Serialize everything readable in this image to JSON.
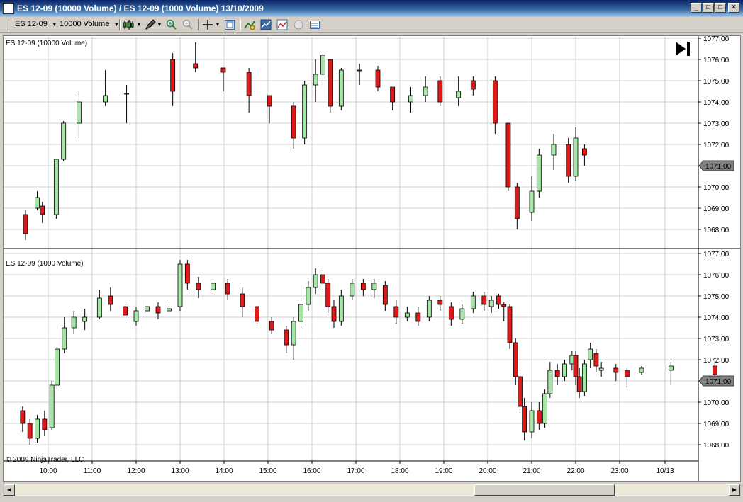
{
  "window": {
    "title": "ES 12-09 (10000 Volume) / ES 12-09 (1000 Volume)  13/10/2009"
  },
  "toolbar": {
    "instrument": "ES 12-09",
    "interval": "10000 Volume"
  },
  "chart_data": [
    {
      "type": "candlestick",
      "title": "ES 12-09 (10000 Volume)",
      "ylim": [
        1067.5,
        1077.0
      ],
      "y_ticks": [
        "1077,00",
        "1076,00",
        "1075,00",
        "1074,00",
        "1073,00",
        "1072,00",
        "1071,00",
        "1070,00",
        "1069,00",
        "1068,00"
      ],
      "last_price": "1071,00",
      "candles": [
        [
          "09:29",
          1068.7,
          1067.8,
          1067.5,
          1068.9
        ],
        [
          "09:45",
          1069.0,
          1069.5,
          1068.9,
          1069.8
        ],
        [
          "09:52",
          1069.1,
          1068.7,
          1068.3,
          1069.3
        ],
        [
          "10:11",
          1068.7,
          1071.3,
          1068.5,
          1071.3
        ],
        [
          "10:21",
          1071.3,
          1073.0,
          1071.2,
          1073.1
        ],
        [
          "10:42",
          1073.0,
          1074.0,
          1072.3,
          1074.5
        ],
        [
          "11:18",
          1074.0,
          1074.3,
          1073.8,
          1075.5
        ],
        [
          "11:47",
          1074.4,
          1074.4,
          1073.0,
          1074.8
        ],
        [
          "12:50",
          1076.0,
          1074.5,
          1073.8,
          1076.3
        ],
        [
          "13:21",
          1075.8,
          1075.6,
          1075.4,
          1076.8
        ],
        [
          "13:59",
          1075.6,
          1075.4,
          1074.5,
          1075.6
        ],
        [
          "14:34",
          1075.4,
          1074.3,
          1073.5,
          1075.6
        ],
        [
          "15:02",
          1074.3,
          1073.8,
          1073.0,
          1074.3
        ],
        [
          "15:35",
          1073.8,
          1072.3,
          1071.8,
          1074.0
        ],
        [
          "15:50",
          1072.3,
          1074.8,
          1072.0,
          1075.0
        ],
        [
          "16:05",
          1074.8,
          1075.3,
          1074.0,
          1076.0
        ],
        [
          "16:15",
          1075.3,
          1076.2,
          1075.0,
          1076.3
        ],
        [
          "16:25",
          1076.0,
          1073.8,
          1073.5,
          1076.0
        ],
        [
          "16:40",
          1073.8,
          1075.5,
          1073.6,
          1075.6
        ],
        [
          "17:05",
          1075.5,
          1075.5,
          1074.8,
          1075.8
        ],
        [
          "17:30",
          1075.5,
          1074.7,
          1074.5,
          1075.7
        ],
        [
          "17:50",
          1074.7,
          1074.0,
          1073.6,
          1074.7
        ],
        [
          "18:15",
          1074.0,
          1074.3,
          1073.5,
          1074.7
        ],
        [
          "18:35",
          1074.3,
          1074.7,
          1074.0,
          1075.2
        ],
        [
          "18:55",
          1075.0,
          1074.0,
          1073.8,
          1075.2
        ],
        [
          "19:20",
          1074.2,
          1074.5,
          1073.8,
          1075.2
        ],
        [
          "19:40",
          1075.0,
          1074.6,
          1074.3,
          1075.2
        ],
        [
          "20:10",
          1075.0,
          1073.0,
          1072.5,
          1075.2
        ],
        [
          "20:28",
          1073.0,
          1070.0,
          1069.8,
          1073.0
        ],
        [
          "20:40",
          1070.0,
          1068.5,
          1068.0,
          1070.2
        ],
        [
          "21:00",
          1068.8,
          1069.8,
          1068.4,
          1070.5
        ],
        [
          "21:10",
          1069.8,
          1071.5,
          1069.5,
          1071.8
        ],
        [
          "21:30",
          1071.5,
          1072.0,
          1070.8,
          1072.5
        ],
        [
          "21:50",
          1072.0,
          1070.5,
          1070.2,
          1072.3
        ],
        [
          "22:00",
          1070.5,
          1072.3,
          1070.3,
          1072.8
        ],
        [
          "22:12",
          1071.8,
          1071.5,
          1071.0,
          1072.0
        ]
      ]
    },
    {
      "type": "candlestick",
      "title": "ES 12-09 (1000 Volume)",
      "ylim": [
        1067.5,
        1077.0
      ],
      "y_ticks": [
        "1077,00",
        "1076,00",
        "1075,00",
        "1074,00",
        "1073,00",
        "1072,00",
        "1071,00",
        "1070,00",
        "1069,00",
        "1068,00"
      ],
      "x_ticks": [
        "10:00",
        "11:00",
        "12:00",
        "13:00",
        "14:00",
        "15:00",
        "16:00",
        "17:00",
        "18:00",
        "19:00",
        "20:00",
        "21:00",
        "22:00",
        "23:00",
        "10/13"
      ],
      "last_price": "1071,00",
      "candles": [
        [
          "09:25",
          1069.6,
          1069.0,
          1068.6,
          1069.8
        ],
        [
          "09:35",
          1069.0,
          1068.3,
          1068.0,
          1069.2
        ],
        [
          "09:45",
          1068.3,
          1069.2,
          1068.1,
          1069.4
        ],
        [
          "09:55",
          1069.2,
          1068.7,
          1068.4,
          1069.6
        ],
        [
          "10:05",
          1068.8,
          1070.8,
          1068.7,
          1071.0
        ],
        [
          "10:12",
          1070.8,
          1072.5,
          1070.6,
          1072.6
        ],
        [
          "10:22",
          1072.5,
          1073.5,
          1072.3,
          1074.0
        ],
        [
          "10:35",
          1073.5,
          1074.0,
          1073.2,
          1074.3
        ],
        [
          "10:50",
          1073.8,
          1074.0,
          1073.4,
          1074.4
        ],
        [
          "11:10",
          1074.0,
          1074.9,
          1073.9,
          1075.3
        ],
        [
          "11:25",
          1075.0,
          1074.6,
          1074.3,
          1075.4
        ],
        [
          "11:45",
          1074.5,
          1074.1,
          1073.8,
          1074.6
        ],
        [
          "12:00",
          1073.8,
          1074.3,
          1073.6,
          1074.5
        ],
        [
          "12:15",
          1074.3,
          1074.5,
          1074.1,
          1074.8
        ],
        [
          "12:30",
          1074.5,
          1074.2,
          1073.9,
          1074.7
        ],
        [
          "12:45",
          1074.3,
          1074.4,
          1074.0,
          1074.6
        ],
        [
          "13:00",
          1074.5,
          1076.5,
          1074.3,
          1076.7
        ],
        [
          "13:10",
          1076.5,
          1075.6,
          1075.3,
          1076.7
        ],
        [
          "13:25",
          1075.6,
          1075.3,
          1074.9,
          1075.9
        ],
        [
          "13:45",
          1075.3,
          1075.6,
          1075.1,
          1075.8
        ],
        [
          "14:05",
          1075.6,
          1075.1,
          1074.8,
          1075.8
        ],
        [
          "14:25",
          1075.1,
          1074.5,
          1074.0,
          1075.4
        ],
        [
          "14:45",
          1074.5,
          1073.8,
          1073.6,
          1074.8
        ],
        [
          "15:05",
          1073.8,
          1073.4,
          1073.2,
          1074.0
        ],
        [
          "15:25",
          1073.4,
          1072.7,
          1072.3,
          1073.6
        ],
        [
          "15:35",
          1072.7,
          1073.8,
          1072.0,
          1074.0
        ],
        [
          "15:45",
          1073.8,
          1074.6,
          1073.5,
          1074.9
        ],
        [
          "15:55",
          1074.6,
          1075.4,
          1074.3,
          1075.7
        ],
        [
          "16:05",
          1075.4,
          1076.0,
          1075.1,
          1076.3
        ],
        [
          "16:15",
          1076.0,
          1075.6,
          1075.3,
          1076.2
        ],
        [
          "16:22",
          1075.6,
          1074.5,
          1074.2,
          1075.8
        ],
        [
          "16:30",
          1074.5,
          1073.8,
          1073.5,
          1074.8
        ],
        [
          "16:40",
          1073.8,
          1075.0,
          1073.6,
          1075.3
        ],
        [
          "16:55",
          1075.0,
          1075.6,
          1074.8,
          1075.8
        ],
        [
          "17:10",
          1075.6,
          1075.3,
          1075.0,
          1075.8
        ],
        [
          "17:25",
          1075.3,
          1075.6,
          1074.9,
          1075.8
        ],
        [
          "17:40",
          1075.5,
          1074.6,
          1074.3,
          1075.7
        ],
        [
          "17:55",
          1074.5,
          1074.0,
          1073.7,
          1074.8
        ],
        [
          "18:10",
          1074.0,
          1074.2,
          1073.8,
          1074.5
        ],
        [
          "18:25",
          1074.2,
          1073.8,
          1073.6,
          1074.5
        ],
        [
          "18:40",
          1074.0,
          1074.8,
          1073.8,
          1075.0
        ],
        [
          "18:55",
          1074.8,
          1074.6,
          1074.3,
          1075.0
        ],
        [
          "19:10",
          1074.5,
          1073.9,
          1073.6,
          1074.7
        ],
        [
          "19:25",
          1073.9,
          1074.4,
          1073.7,
          1074.6
        ],
        [
          "19:40",
          1074.4,
          1075.0,
          1074.2,
          1075.2
        ],
        [
          "19:55",
          1075.0,
          1074.6,
          1074.3,
          1075.2
        ],
        [
          "20:05",
          1074.5,
          1074.8,
          1074.2,
          1075.0
        ],
        [
          "20:15",
          1075.0,
          1074.6,
          1074.4,
          1075.1
        ],
        [
          "20:22",
          1074.6,
          1074.5,
          1073.8,
          1074.7
        ],
        [
          "20:30",
          1074.5,
          1072.8,
          1072.5,
          1074.6
        ],
        [
          "20:38",
          1072.8,
          1071.2,
          1070.8,
          1073.0
        ],
        [
          "20:44",
          1071.2,
          1069.8,
          1069.5,
          1071.4
        ],
        [
          "20:50",
          1069.8,
          1068.6,
          1068.2,
          1070.2
        ],
        [
          "21:00",
          1068.6,
          1069.6,
          1068.3,
          1070.0
        ],
        [
          "21:10",
          1069.6,
          1069.0,
          1068.7,
          1070.0
        ],
        [
          "21:18",
          1069.0,
          1070.4,
          1068.8,
          1070.6
        ],
        [
          "21:25",
          1070.4,
          1071.5,
          1070.2,
          1071.9
        ],
        [
          "21:35",
          1071.5,
          1071.2,
          1070.8,
          1071.8
        ],
        [
          "21:45",
          1071.2,
          1071.8,
          1071.0,
          1072.0
        ],
        [
          "21:55",
          1071.8,
          1072.2,
          1071.5,
          1072.4
        ],
        [
          "22:00",
          1072.2,
          1071.2,
          1070.8,
          1072.4
        ],
        [
          "22:05",
          1071.2,
          1070.5,
          1070.2,
          1071.6
        ],
        [
          "22:12",
          1070.5,
          1071.8,
          1070.3,
          1072.0
        ],
        [
          "22:20",
          1072.0,
          1072.5,
          1071.6,
          1072.8
        ],
        [
          "22:28",
          1072.3,
          1071.7,
          1071.4,
          1072.5
        ],
        [
          "22:35",
          1071.5,
          1071.6,
          1071.2,
          1071.9
        ],
        [
          "22:55",
          1071.6,
          1071.4,
          1071.0,
          1071.8
        ],
        [
          "23:10",
          1071.5,
          1071.2,
          1070.7,
          1071.6
        ],
        [
          "23:30",
          1071.4,
          1071.6,
          1071.3,
          1071.7
        ],
        [
          "00:10",
          1071.5,
          1071.7,
          1070.8,
          1071.9
        ],
        [
          "01:10",
          1071.7,
          1071.3,
          1071.2,
          1072.0
        ]
      ]
    }
  ],
  "copyright": "© 2009 NinjaTrader, LLC"
}
